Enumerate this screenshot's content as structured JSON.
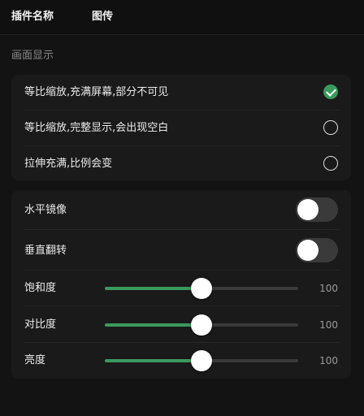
{
  "header": {
    "columns": [
      "插件名称",
      "图传"
    ]
  },
  "display_section": {
    "title": "画面显示",
    "options": [
      {
        "label": "等比缩放,充满屏幕,部分不可见",
        "selected": true
      },
      {
        "label": "等比缩放,完整显示,会出现空白",
        "selected": false
      },
      {
        "label": "拉伸充满,比例会变",
        "selected": false
      }
    ]
  },
  "adjustments": {
    "toggles": [
      {
        "label": "水平镜像",
        "on": false
      },
      {
        "label": "垂直翻转",
        "on": false
      }
    ],
    "sliders": [
      {
        "label": "饱和度",
        "value": 100,
        "value_text": "100",
        "fraction": 0.5
      },
      {
        "label": "对比度",
        "value": 100,
        "value_text": "100",
        "fraction": 0.5
      },
      {
        "label": "亮度",
        "value": 100,
        "value_text": "100",
        "fraction": 0.5
      }
    ]
  },
  "colors": {
    "accent": "#3a9a5e",
    "background": "#131313",
    "card": "#1a1a1a"
  }
}
